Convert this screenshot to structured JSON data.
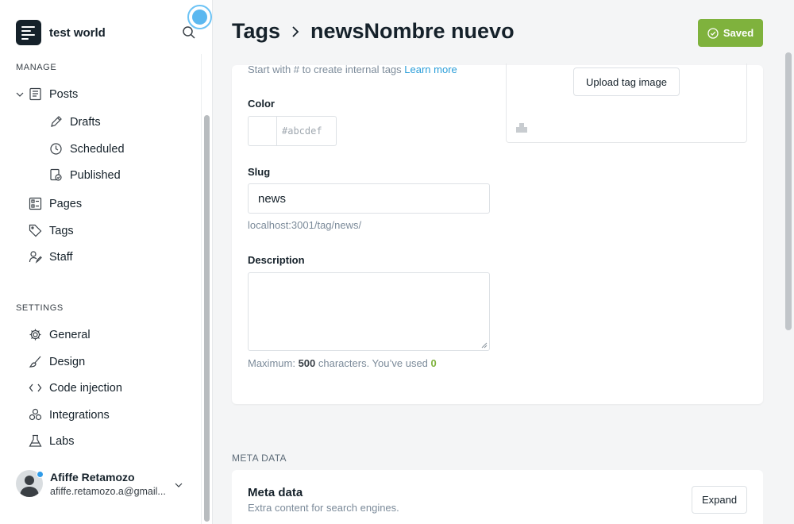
{
  "sidebar": {
    "site_name": "test world",
    "manage_label": "MANAGE",
    "settings_label": "SETTINGS",
    "items": {
      "posts": "Posts",
      "drafts": "Drafts",
      "scheduled": "Scheduled",
      "published": "Published",
      "pages": "Pages",
      "tags": "Tags",
      "staff": "Staff",
      "general": "General",
      "design": "Design",
      "code_injection": "Code injection",
      "integrations": "Integrations",
      "labs": "Labs"
    },
    "user": {
      "name": "Afiffe Retamozo",
      "email": "afiffe.retamozo.a@gmail..."
    }
  },
  "header": {
    "breadcrumb_root": "Tags",
    "breadcrumb_current": "newsNombre nuevo",
    "saved_label": "Saved"
  },
  "form": {
    "hint_text": "Start with # to create internal tags ",
    "hint_link": "Learn more",
    "color_label": "Color",
    "color_placeholder": "#abcdef",
    "slug_label": "Slug",
    "slug_value": "news",
    "slug_url": "localhost:3001/tag/news/",
    "description_label": "Description",
    "description_value": "",
    "count_prefix": "Maximum: ",
    "count_max": "500",
    "count_middle": " characters. You’ve used ",
    "count_used": "0",
    "upload_label": "Upload tag image"
  },
  "meta": {
    "section_label": "META DATA",
    "title": "Meta data",
    "subtitle": "Extra content for search engines.",
    "expand_label": "Expand"
  },
  "colors": {
    "accent_green": "#7fb23d",
    "link_blue": "#2b9ed9",
    "dark": "#15212a"
  }
}
